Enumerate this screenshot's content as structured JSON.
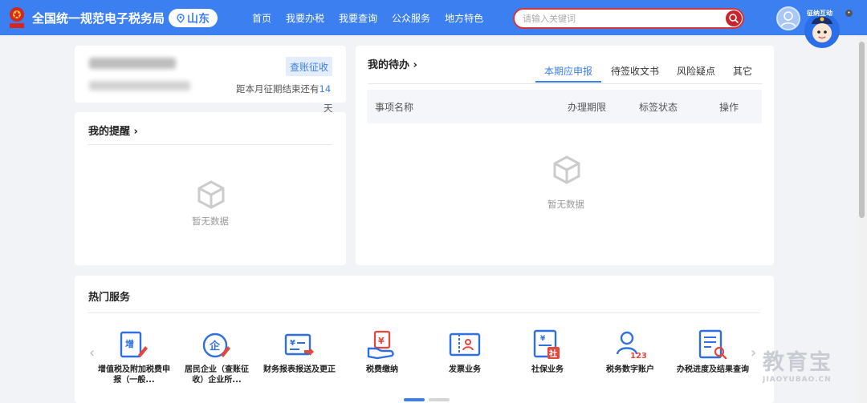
{
  "header": {
    "site_title": "全国统一规范电子税务局",
    "region": "山东",
    "nav": [
      "首页",
      "我要办税",
      "我要查询",
      "公众服务",
      "地方特色"
    ],
    "search_placeholder": "请输入关键词",
    "mascot_text": "征纳互动"
  },
  "account": {
    "query_button": "查账征收",
    "deadline_prefix": "距本月征期结束还有",
    "deadline_days": "14",
    "deadline_unit": "天"
  },
  "reminders": {
    "title": "我的提醒 ›",
    "empty_text": "暂无数据"
  },
  "todo": {
    "title": "我的待办 ›",
    "tabs": [
      "本期应申报",
      "待签收文书",
      "风险疑点",
      "其它"
    ],
    "columns": [
      "事项名称",
      "办理期限",
      "标签状态",
      "操作"
    ],
    "empty_text": "暂无数据"
  },
  "hot_services": {
    "title": "热门服务",
    "items": [
      {
        "label": "增值税及附加税费申报（一般...",
        "icon": "vat-declare-icon"
      },
      {
        "label": "居民企业（查账征收）企业所...",
        "icon": "enterprise-tax-icon"
      },
      {
        "label": "财务报表报送及更正",
        "icon": "financial-report-icon"
      },
      {
        "label": "税费缴纳",
        "icon": "tax-payment-icon"
      },
      {
        "label": "发票业务",
        "icon": "invoice-icon"
      },
      {
        "label": "社保业务",
        "icon": "social-security-icon"
      },
      {
        "label": "税务数字账户",
        "icon": "digital-account-icon"
      },
      {
        "label": "办税进度及结果查询",
        "icon": "progress-query-icon"
      }
    ],
    "prev_arrow": "‹",
    "next_arrow": "›"
  },
  "watermark": {
    "main": "教育宝",
    "sub": "JIAOYUBAO.CN"
  },
  "colors": {
    "primary": "#3b7ff0",
    "search_border": "#d9343b",
    "icon_blue": "#2f6fe0",
    "icon_red": "#e5473d"
  }
}
